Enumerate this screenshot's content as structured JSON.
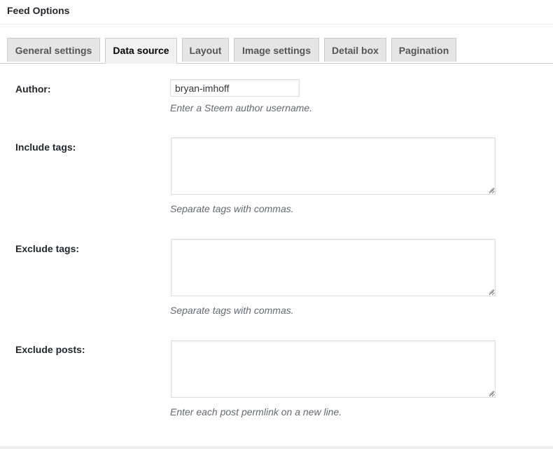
{
  "panel": {
    "title": "Feed Options"
  },
  "tabs": [
    {
      "label": "General settings",
      "active": false
    },
    {
      "label": "Data source",
      "active": true
    },
    {
      "label": "Layout",
      "active": false
    },
    {
      "label": "Image settings",
      "active": false
    },
    {
      "label": "Detail box",
      "active": false
    },
    {
      "label": "Pagination",
      "active": false
    }
  ],
  "fields": {
    "author": {
      "label": "Author:",
      "value": "bryan-imhoff",
      "description": "Enter a Steem author username."
    },
    "include_tags": {
      "label": "Include tags:",
      "value": "",
      "description": "Separate tags with commas."
    },
    "exclude_tags": {
      "label": "Exclude tags:",
      "value": "",
      "description": "Separate tags with commas."
    },
    "exclude_posts": {
      "label": "Exclude posts:",
      "value": "",
      "description": "Enter each post permlink on a new line."
    }
  },
  "icons": {
    "textarea_resize": "resize-handle-icon"
  },
  "colors": {
    "active_tab_bg": "#f1f1f1",
    "inactive_tab_bg": "#e5e5e5",
    "border": "#cccccc",
    "description_text": "#646970"
  }
}
